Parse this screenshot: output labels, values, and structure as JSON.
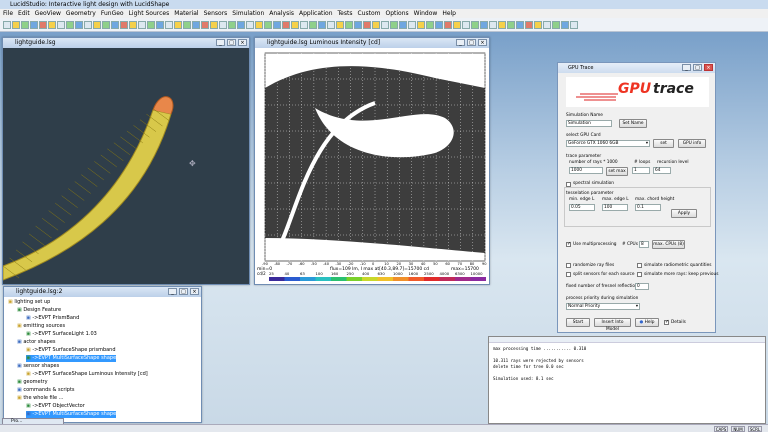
{
  "app": {
    "title": "LucidStudio: Interactive light design with LucidShape"
  },
  "menu": [
    "File",
    "Edit",
    "GeoView",
    "Geometry",
    "FunGeo",
    "Light Sources",
    "Material",
    "Sensors",
    "Simulation",
    "Analysis",
    "Application",
    "Tests",
    "Custom",
    "Options",
    "Window",
    "Help"
  ],
  "geo_window": {
    "title": "lightguide.lsg"
  },
  "plot_window": {
    "title": "lightguide.lsg  Luminous Intensity [cd]",
    "footer_left": "min=0",
    "footer_mid": "flux=109 lm, I max at[40.3,89.7]=15700 cd",
    "footer_right": "max=15700",
    "x_ticks": [
      "-90",
      "-80",
      "-70",
      "-60",
      "-50",
      "-40",
      "-30",
      "-20",
      "-10",
      "0",
      "10",
      "20",
      "30",
      "40",
      "50",
      "60",
      "70",
      "80",
      "90"
    ],
    "legend_label": "cd/2",
    "legend_values": [
      "25",
      "40",
      "63",
      "100",
      "160",
      "250",
      "400",
      "630",
      "1000",
      "1600",
      "2500",
      "4000",
      "6300",
      "10000"
    ]
  },
  "gpu": {
    "title": "GPU Trace",
    "logo_a": "GPU",
    "logo_b": "trace",
    "sim_name_label": "Simulation Name",
    "sim_name_value": "Simulation",
    "set_name": "Set Name",
    "card_label": "select GPU Card",
    "card_value": "GeForce GTX 1060 6GB",
    "set": "set",
    "gpu_info": "GPU info",
    "trace_param": "trace parameter",
    "rays_label": "number of rays * 1000",
    "rays_value": "1000",
    "set_max": "set max",
    "loops_label": "# loops",
    "loops_value": "1",
    "rec_label": "recursion level",
    "rec_value": "64",
    "spectral": "spectral simulation",
    "tess_label": "tesselation parameter",
    "min_edge_label": "min. edge L",
    "min_edge_value": "0.05",
    "max_edge_label": "max. edge L",
    "max_edge_value": "100",
    "chord_label": "max. chord height",
    "chord_value": "0.1",
    "apply": "Apply",
    "multi": "Use multiprocessing",
    "cpus_label": "# CPUs",
    "cpus_value": "8",
    "max_cpus": "max. CPUs (8)",
    "randomize": "randomize ray files",
    "split": "split sensors for each source",
    "sim_rad": "simulate radiometric quantities",
    "sim_more": "simulate more rays: keep previous",
    "fresnel_label": "fixed number of fresnel reflections",
    "fresnel_value": "0",
    "priority_label": "process priority during simulation",
    "priority_value": "Normal Priority",
    "start": "Start",
    "insert": "Insert Into Model",
    "help": "Help",
    "details": "Details"
  },
  "tree": {
    "title": "lightguide.lsg:2",
    "rows": [
      "lighting set up",
      "Design Feature",
      "->EVPT PrismBand",
      "emitting sources",
      "->EVPT SurfaceLight   1.03",
      "actor shapes",
      "->EVPT SurfaceShape   prismband",
      "->EVPT MultiSurfaceShape   shape",
      "sensor shapes",
      "->EVPT SurfaceShape   Luminous Intensity [cd]",
      "geometry",
      "commands & scripts",
      "the whole file ...",
      "->EVPT ObjectVector",
      "->EVPT MultiSurfaceShape   shape"
    ]
  },
  "console": {
    "lines": [
      "max processing time ........... 0.310",
      "",
      "10.311 rays were rejected by sensors",
      "delete time for tree 0.0 sec",
      "",
      "Simulation used: 8.1 sec"
    ]
  },
  "taskbar": {
    "item": "Pro..."
  },
  "status": [
    "CAPS",
    "NUM",
    "SCRL"
  ]
}
